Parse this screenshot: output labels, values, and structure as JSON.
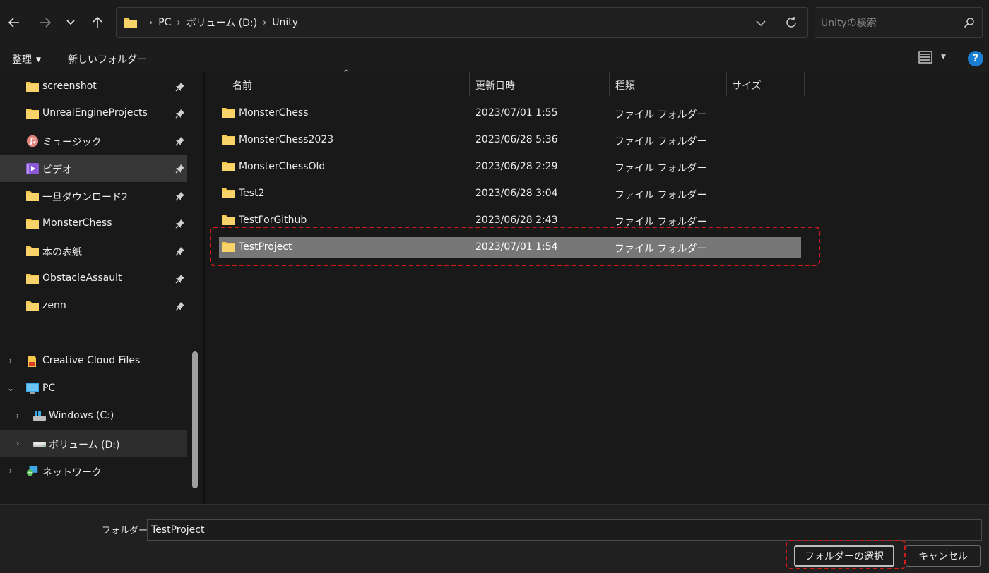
{
  "nav": {
    "back_icon": "arrow-left-icon",
    "forward_icon": "arrow-right-icon",
    "recent_icon": "chevron-down-icon",
    "up_icon": "arrow-up-icon"
  },
  "address": {
    "crumbs": [
      "PC",
      "ボリューム (D:)",
      "Unity"
    ],
    "separator": "›"
  },
  "search": {
    "placeholder": "Unityの検索"
  },
  "commands": {
    "organize": "整理",
    "new_folder": "新しいフォルダー"
  },
  "sidebar": {
    "quick_access": [
      {
        "label": "screenshot",
        "icon": "folder-icon",
        "pinned": true
      },
      {
        "label": "UnrealEngineProjects",
        "icon": "folder-icon",
        "pinned": true
      },
      {
        "label": "ミュージック",
        "icon": "music-icon",
        "pinned": true
      },
      {
        "label": "ビデオ",
        "icon": "video-icon",
        "pinned": true,
        "active": true
      },
      {
        "label": "一旦ダウンロード2",
        "icon": "folder-icon",
        "pinned": true
      },
      {
        "label": "MonsterChess",
        "icon": "folder-icon",
        "pinned": true
      },
      {
        "label": "本の表紙",
        "icon": "folder-icon",
        "pinned": true
      },
      {
        "label": "ObstacleAssault",
        "icon": "folder-icon",
        "pinned": true
      },
      {
        "label": "zenn",
        "icon": "folder-icon",
        "pinned": true
      }
    ],
    "tree": [
      {
        "label": "Creative Cloud Files",
        "icon": "creative-cloud-icon",
        "expanded": false
      },
      {
        "label": "PC",
        "icon": "pc-icon",
        "expanded": true
      },
      {
        "label": "Windows (C:)",
        "icon": "windows-drive-icon",
        "expanded": false
      },
      {
        "label": "ボリューム (D:)",
        "icon": "drive-icon",
        "expanded": false,
        "active": true
      },
      {
        "label": "ネットワーク",
        "icon": "network-icon",
        "expanded": false
      }
    ]
  },
  "columns": {
    "name": "名前",
    "modified": "更新日時",
    "type": "種類",
    "size": "サイズ"
  },
  "files": [
    {
      "name": "MonsterChess",
      "modified": "2023/07/01 1:55",
      "type": "ファイル フォルダー"
    },
    {
      "name": "MonsterChess2023",
      "modified": "2023/06/28 5:36",
      "type": "ファイル フォルダー"
    },
    {
      "name": "MonsterChessOld",
      "modified": "2023/06/28 2:29",
      "type": "ファイル フォルダー"
    },
    {
      "name": "Test2",
      "modified": "2023/06/28 3:04",
      "type": "ファイル フォルダー"
    },
    {
      "name": "TestForGithub",
      "modified": "2023/06/28 2:43",
      "type": "ファイル フォルダー"
    },
    {
      "name": "TestProject",
      "modified": "2023/07/01 1:54",
      "type": "ファイル フォルダー",
      "selected": true
    }
  ],
  "footer": {
    "folder_label": "フォルダー:",
    "folder_value": "TestProject",
    "select_button": "フォルダーの選択",
    "cancel_button": "キャンセル"
  },
  "colors": {
    "accent_help": "#1a7fd4",
    "highlight_box": "#d01a1a",
    "selected_row": "#777777",
    "folder_yellow": "#f5c84c"
  }
}
